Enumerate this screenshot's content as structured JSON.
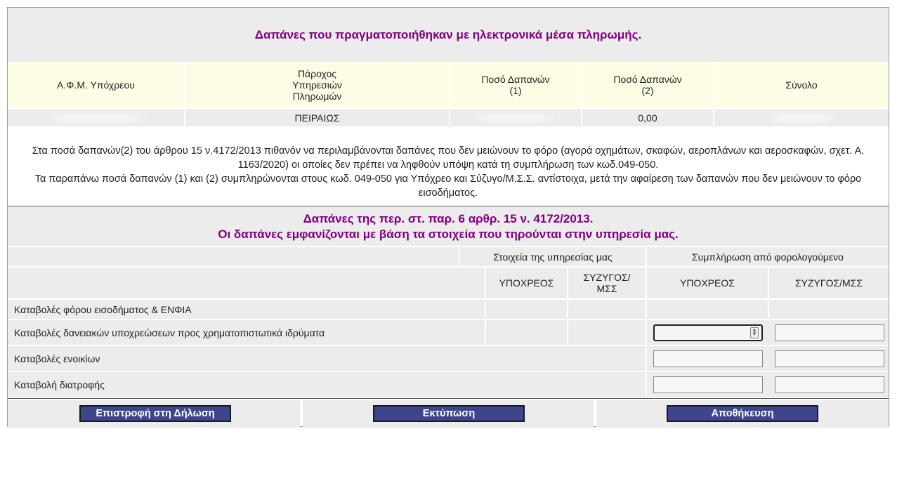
{
  "section1": {
    "title": "Δαπάνες που πραγματοποιήθηκαν με ηλεκτρονικά μέσα πληρωμής.",
    "columns": [
      "Α.Φ.Μ. Υπόχρεου",
      "Πάροχος\nΥπηρεσιών\nΠληρωμών",
      "Ποσό Δαπανών\n(1)",
      "Ποσό Δαπανών\n(2)",
      "Σύνολο"
    ],
    "row": {
      "afm": "",
      "provider": "ΠΕΙΡΑΙΩΣ",
      "amount1": "",
      "amount2": "0,00",
      "total": ""
    },
    "note1": "Στα ποσά δαπανών(2) του άρθρου 15 ν.4172/2013 πιθανόν να περιλαμβάνονται δαπάνες που δεν μειώνουν το φόρο (αγορά οχημάτων, σκαφών, αεροπλάνων και αεροσκαφών, σχετ. Α. 1163/2020) οι οποίες δεν πρέπει να ληφθούν υπόψη κατά τη συμπλήρωση των κωδ.049-050.",
    "note2": "Τα παραπάνω ποσά δαπανών (1) και (2) συμπληρώνονται στους κωδ. 049-050 για Υπόχρεο και Σύζυγο/Μ.Σ.Σ. αντίστοιχα, μετά την αφαίρεση των δαπανών που δεν μειώνουν το φόρο εισοδήματος."
  },
  "section2": {
    "title_line1": "Δαπάνες της περ. στ. παρ. 6 αρθρ. 15 ν. 4172/2013.",
    "title_line2": "Οι δαπάνες εμφανίζονται με βάση τα στοιχεία που τηρούνται στην υπηρεσία μας.",
    "group_service": "Στοιχεία της υπηρεσίας μας",
    "group_taxpayer": "Συμπλήρωση από φορολογούμενο",
    "col_obligor": "ΥΠΟΧΡΕΟΣ",
    "col_spouse": "ΣΥΖΥΓΟΣ/\nΜΣΣ",
    "col_obligor2": "ΥΠΟΧΡΕΟΣ",
    "col_spouse2": "ΣΥΖΥΓΟΣ/ΜΣΣ",
    "rows": [
      "Καταβολές φόρου εισοδήματος & ΕΝΦΙΑ",
      "Καταβολές δανειακών υποχρεώσεων προς χρηματοπιστωτικά ιδρύματα",
      "Καταβολές ενοικίων",
      "Καταβολή διατροφής"
    ]
  },
  "buttons": {
    "back": "Επιστροφή στη Δήλωση",
    "print": "Εκτύπωση",
    "save": "Αποθήκευση"
  },
  "colors": {
    "title": "#800080",
    "button_bg": "#3d468c",
    "header_bg": "#fdfde5",
    "band_bg": "#ececec"
  }
}
